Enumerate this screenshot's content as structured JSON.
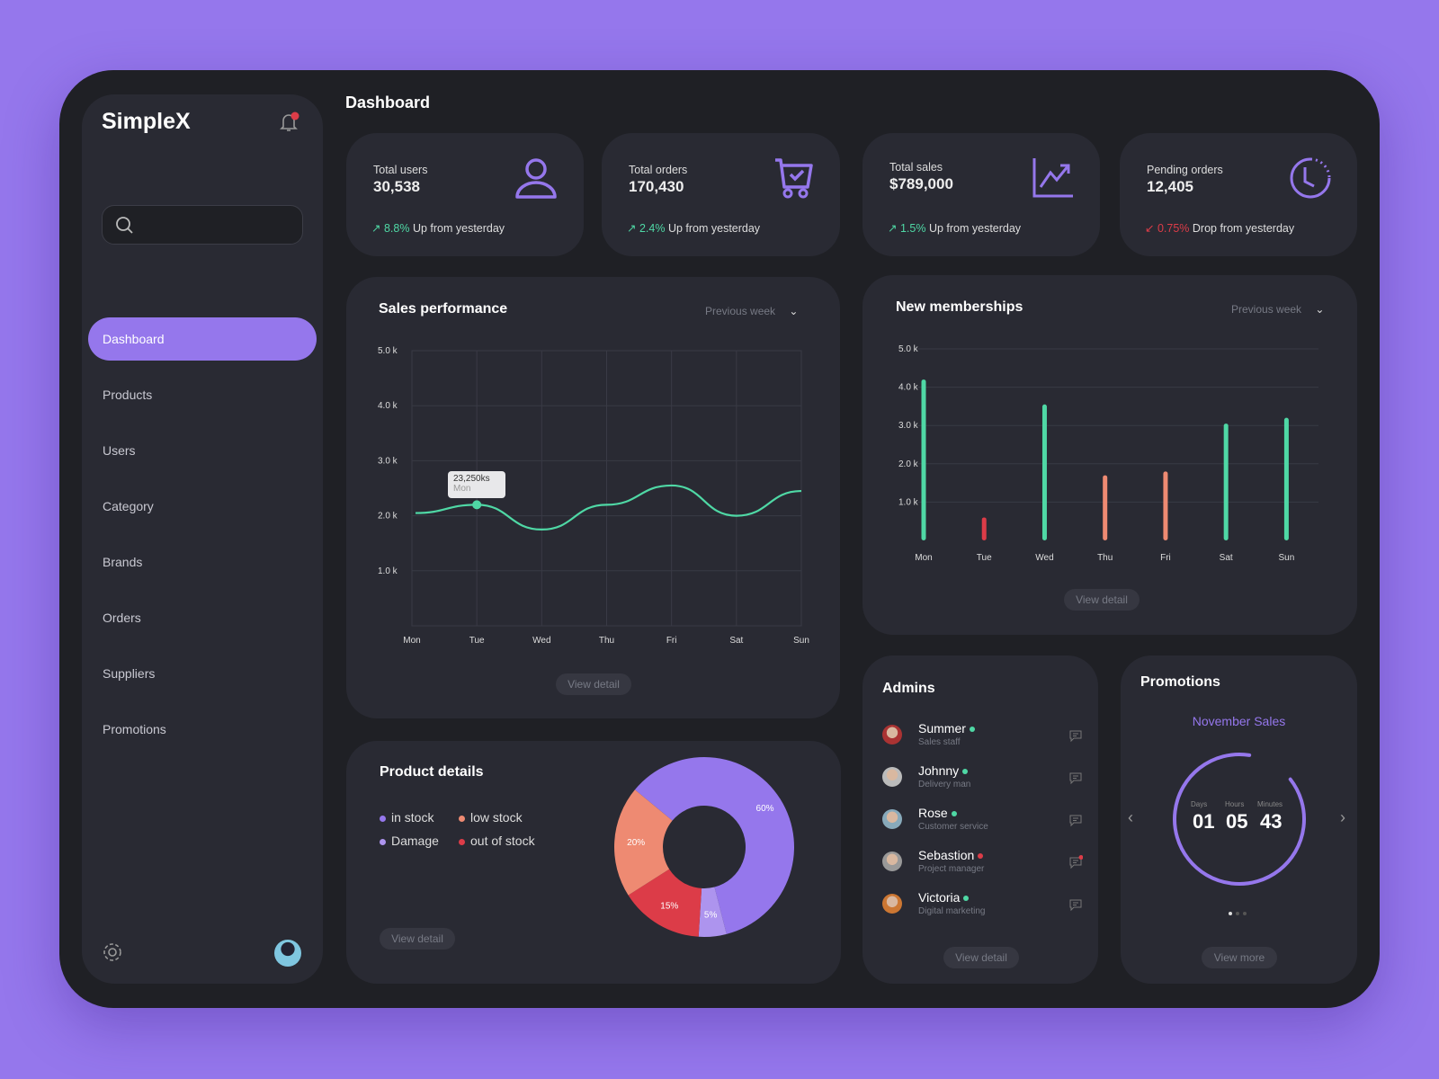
{
  "app": {
    "name": "SimpleX",
    "page_title": "Dashboard"
  },
  "search": {
    "placeholder": ""
  },
  "sidebar": {
    "items": [
      {
        "label": "Dashboard",
        "active": true
      },
      {
        "label": "Products"
      },
      {
        "label": "Users"
      },
      {
        "label": "Category"
      },
      {
        "label": "Brands"
      },
      {
        "label": "Orders"
      },
      {
        "label": "Suppliers"
      },
      {
        "label": "Promotions"
      }
    ]
  },
  "stats": [
    {
      "label": "Total users",
      "value": "30,538",
      "change": "8.8%",
      "change_text": "Up from yesterday",
      "direction": "up",
      "icon": "user-icon"
    },
    {
      "label": "Total orders",
      "value": "170,430",
      "change": "2.4%",
      "change_text": "Up from yesterday",
      "direction": "up",
      "icon": "cart-icon"
    },
    {
      "label": "Total sales",
      "value": "$789,000",
      "change": "1.5%",
      "change_text": "Up from yesterday",
      "direction": "up",
      "icon": "chart-icon"
    },
    {
      "label": "Pending orders",
      "value": "12,405",
      "change": "0.75%",
      "change_text": "Drop from yesterday",
      "direction": "down",
      "icon": "clock-icon"
    }
  ],
  "colors": {
    "accent": "#9577ec",
    "green": "#4fd8a5",
    "red": "#dc3c48",
    "salmon": "#ee8a72",
    "lavender": "#ad94ee"
  },
  "sales": {
    "title": "Sales performance",
    "period": "Previous week",
    "view": "View detail",
    "tooltip": {
      "value": "23,250ks",
      "label": "Mon"
    }
  },
  "memberships": {
    "title": "New memberships",
    "period": "Previous week",
    "view": "View detail"
  },
  "products": {
    "title": "Product details",
    "view": "View detail",
    "legend": [
      "in stock",
      "low stock",
      "Damage",
      "out of stock"
    ]
  },
  "admins": {
    "title": "Admins",
    "view": "View detail",
    "list": [
      {
        "name": "Summer",
        "role": "Sales staff",
        "online": true
      },
      {
        "name": "Johnny",
        "role": "Delivery man",
        "online": true
      },
      {
        "name": "Rose",
        "role": "Customer service",
        "online": true
      },
      {
        "name": "Sebastion",
        "role": "Project manager",
        "online": false,
        "unread": true
      },
      {
        "name": "Victoria",
        "role": "Digital marketing",
        "online": true
      }
    ]
  },
  "promotions": {
    "title": "Promotions",
    "name": "November Sales",
    "days_label": "Days",
    "hours_label": "Hours",
    "minutes_label": "Minutes",
    "days": "01",
    "hours": "05",
    "minutes": "43",
    "view": "View more",
    "progress": 0.88,
    "page": 1,
    "pages": 3
  },
  "chart_data": [
    {
      "type": "line",
      "title": "Sales performance",
      "categories": [
        "Mon",
        "Tue",
        "Wed",
        "Thu",
        "Fri",
        "Sat",
        "Sun"
      ],
      "values": [
        2.05,
        2.2,
        1.75,
        2.2,
        2.55,
        2.0,
        2.45
      ],
      "ylim": [
        0,
        5
      ],
      "yticks": [
        "1.0 k",
        "2.0 k",
        "3.0 k",
        "4.0 k",
        "5.0 k"
      ],
      "grid": true
    },
    {
      "type": "bar",
      "title": "New memberships",
      "categories": [
        "Mon",
        "Tue",
        "Wed",
        "Thu",
        "Fri",
        "Sat",
        "Sun"
      ],
      "values": [
        4.2,
        0.6,
        3.55,
        1.7,
        1.8,
        3.05,
        3.2
      ],
      "bar_colors": [
        "#4fd8a5",
        "#dc3c48",
        "#4fd8a5",
        "#ee8a72",
        "#ee8a72",
        "#4fd8a5",
        "#4fd8a5"
      ],
      "ylim": [
        0,
        5
      ],
      "yticks": [
        "1.0 k",
        "2.0 k",
        "3.0 k",
        "4.0 k",
        "5.0 k"
      ],
      "grid": true
    },
    {
      "type": "pie",
      "title": "Product details",
      "labels": [
        "in stock",
        "Damage",
        "out of stock",
        "low stock"
      ],
      "values": [
        60,
        5,
        15,
        20
      ],
      "colors": [
        "#9577ec",
        "#ad94ee",
        "#dc3c48",
        "#ee8a72"
      ],
      "donut": true
    }
  ]
}
